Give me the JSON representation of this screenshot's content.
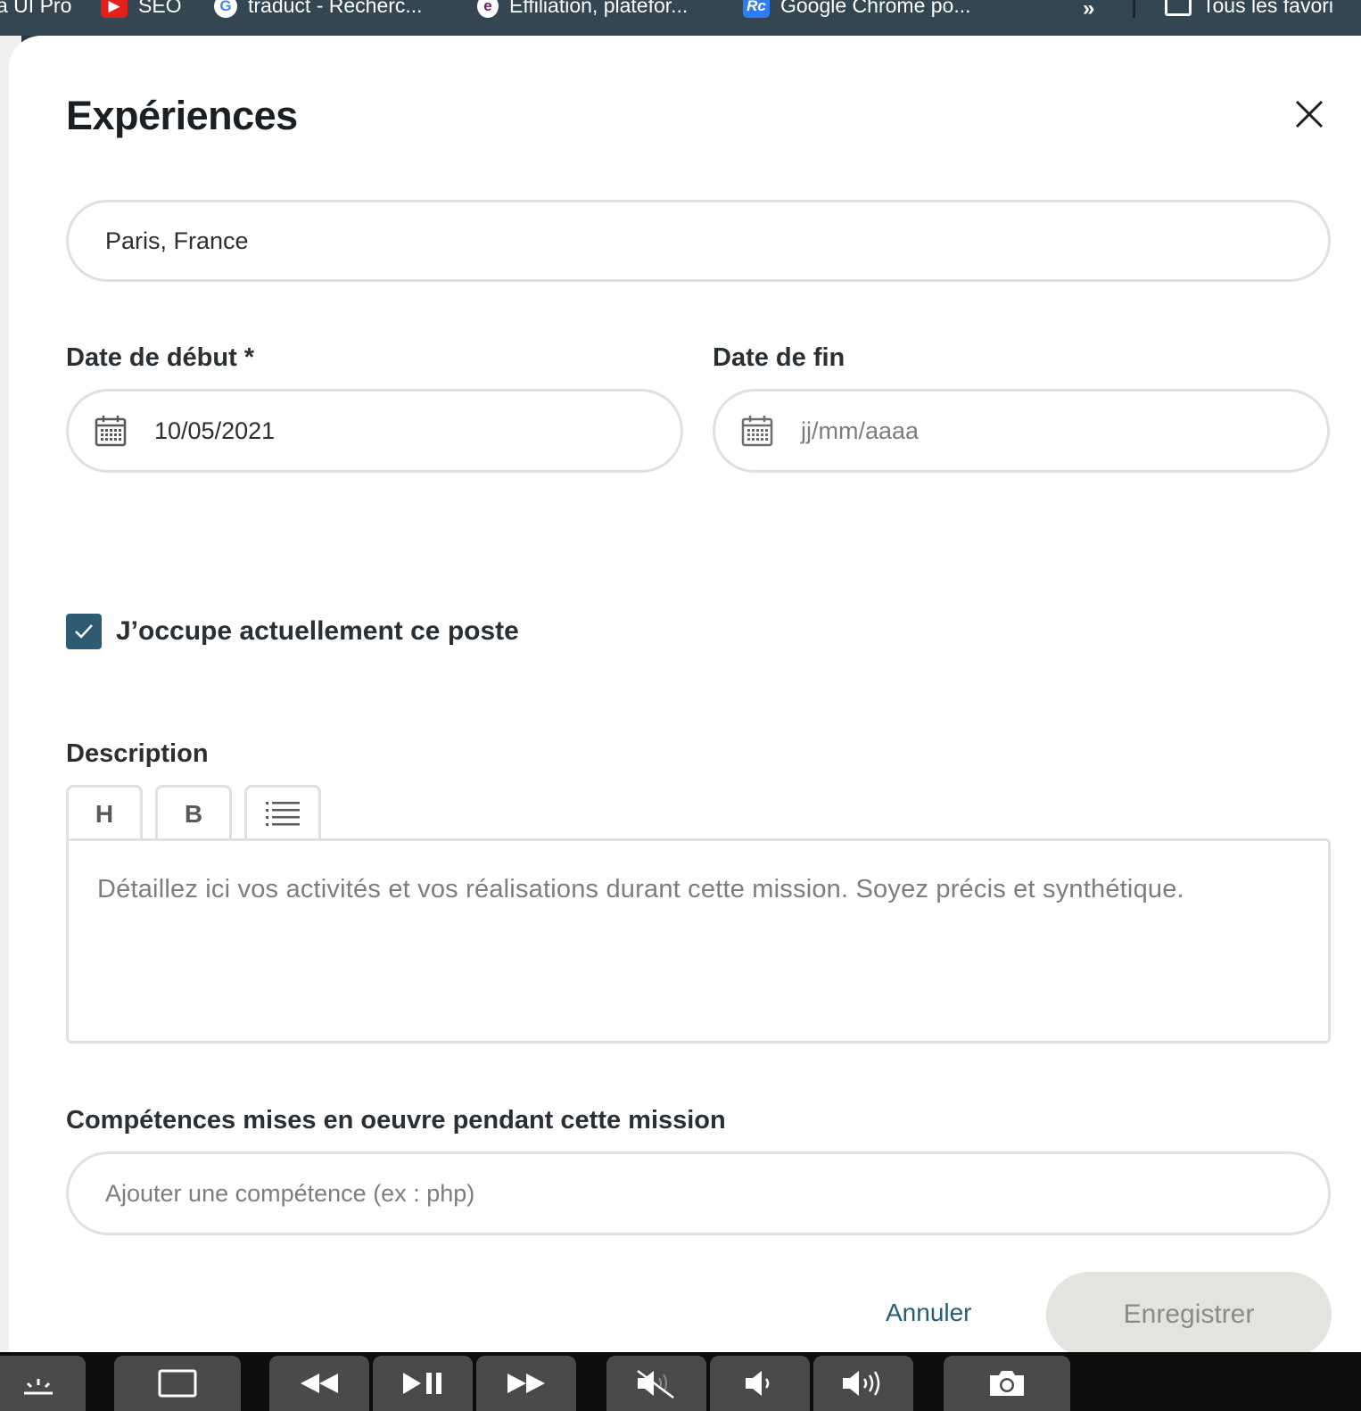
{
  "bookmarks": {
    "items": [
      {
        "label": "a UI Pro"
      },
      {
        "label": "SEO",
        "icon": "youtube-icon"
      },
      {
        "label": "traduct - Recherc...",
        "icon": "google-icon"
      },
      {
        "label": "Effiliation, platefor...",
        "icon": "effiliation-icon"
      },
      {
        "label": "Google Chrome po...",
        "icon": "rc-icon"
      }
    ],
    "overflow_icon": "double-chevron-icon",
    "all_bookmarks_label": "Tous les favori"
  },
  "modal": {
    "title": "Expériences",
    "close_icon": "close-icon",
    "location": {
      "value": "Paris, France"
    },
    "start_date": {
      "label": "Date de début *",
      "value": "10/05/2021",
      "icon": "calendar-icon"
    },
    "end_date": {
      "label": "Date de fin",
      "placeholder": "jj/mm/aaaa",
      "icon": "calendar-icon"
    },
    "current_position": {
      "label": "J’occupe actuellement ce poste",
      "checked": true
    },
    "description": {
      "label": "Description",
      "toolbar": {
        "heading": "H",
        "bold": "B",
        "list_icon": "list-icon"
      },
      "placeholder": "Détaillez ici vos activités et vos réalisations durant cette mission. Soyez précis et synthétique."
    },
    "skills": {
      "label": "Compétences mises en oeuvre pendant cette mission",
      "placeholder": "Ajouter une compétence (ex : php)"
    },
    "actions": {
      "cancel": "Annuler",
      "save": "Enregistrer"
    }
  },
  "controls": [
    "brightness-icon",
    "screen-icon",
    "rewind-icon",
    "play-pause-icon",
    "fast-forward-icon",
    "mute-icon",
    "volume-down-icon",
    "volume-up-icon",
    "camera-icon"
  ],
  "colors": {
    "accent": "#2f5b72",
    "link": "#245d79",
    "border": "#e1e0dc",
    "disabled_button": "#e4e3df",
    "bookmarks_bar": "#334651"
  }
}
